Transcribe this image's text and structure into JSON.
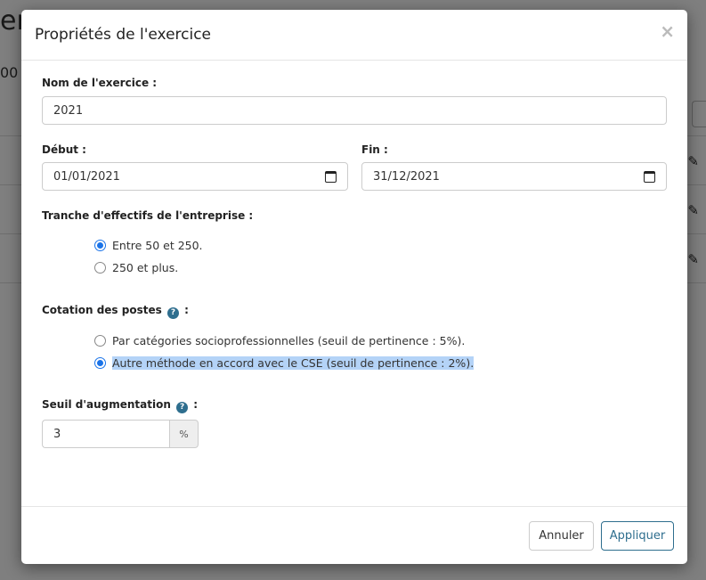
{
  "background": {
    "title_fragment": "er",
    "sub_fragment": "00"
  },
  "modal": {
    "title": "Propriétés de l'exercice",
    "close_symbol": "×",
    "name_field": {
      "label": "Nom de l'exercice :",
      "value": "2021"
    },
    "start_field": {
      "label": "Début :",
      "value": "01/01/2021"
    },
    "end_field": {
      "label": "Fin :",
      "value": "31/12/2021"
    },
    "workforce": {
      "label": "Tranche d'effectifs de l'entreprise :",
      "options": [
        {
          "label": "Entre 50 et 250.",
          "checked": true
        },
        {
          "label": "250 et plus.",
          "checked": false
        }
      ]
    },
    "rating": {
      "label": "Cotation des postes",
      "label_suffix": ":",
      "options": [
        {
          "label": "Par catégories socioprofessionnelles (seuil de pertinence : 5%).",
          "checked": false
        },
        {
          "label": "Autre méthode en accord avec le CSE (seuil de pertinence : 2%).",
          "checked": true
        }
      ]
    },
    "threshold": {
      "label": "Seuil d'augmentation",
      "label_suffix": ":",
      "value": "3",
      "unit": "%"
    },
    "footer": {
      "cancel_label": "Annuler",
      "apply_label": "Appliquer"
    }
  },
  "icons": {
    "help": "question-circle-icon",
    "calendar": "calendar-icon",
    "close": "close-icon",
    "pencil": "pencil-icon"
  },
  "colors": {
    "accent": "#2e6e8e",
    "radio_checked": "#1a73e8",
    "selection_highlight": "#b4d3f7"
  }
}
